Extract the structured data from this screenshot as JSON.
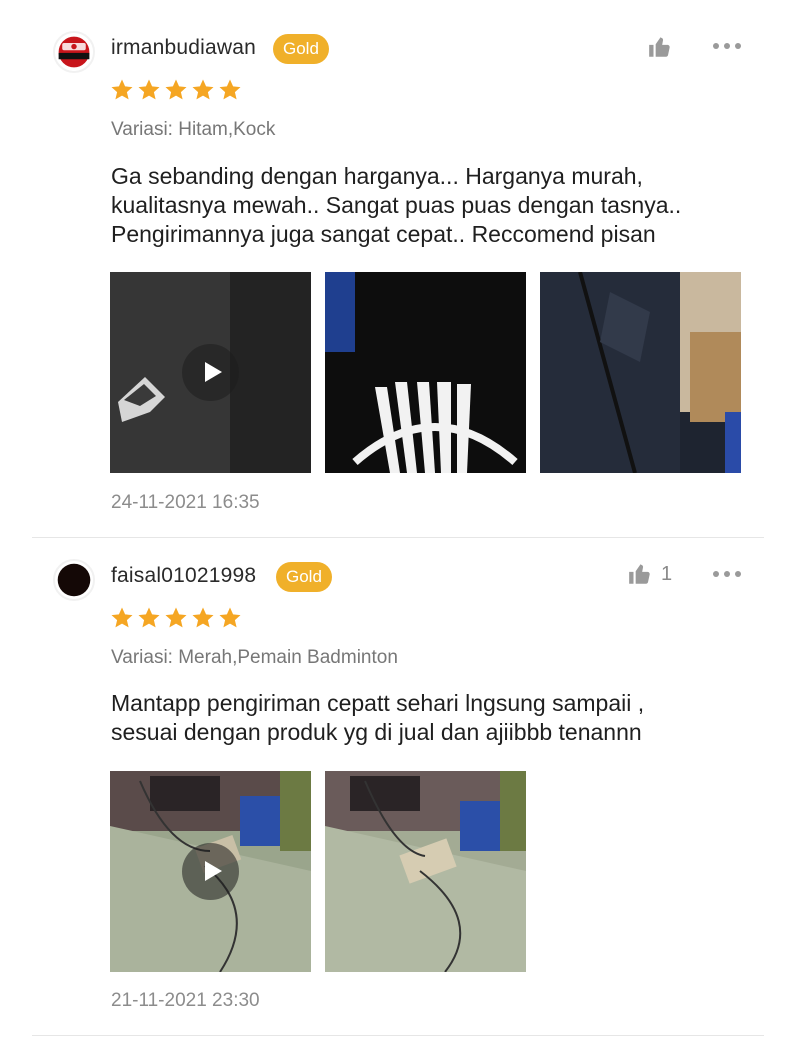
{
  "reviews": [
    {
      "username": "irmanbudiawan",
      "badge": "Gold",
      "rating": 5,
      "variant": "Variasi: Hitam,Kock",
      "text_lines": [
        "Ga sebanding dengan harganya... Harganya murah,",
        "kualitasnya mewah.. Sangat puas puas dengan tasnya..",
        "Pengirimannya juga sangat cepat.. Reccomend pisan"
      ],
      "like_count": "",
      "media": [
        {
          "kind": "video"
        },
        {
          "kind": "image"
        },
        {
          "kind": "image"
        }
      ],
      "date": "24-11-2021 16:35"
    },
    {
      "username": "faisal01021998",
      "badge": "Gold",
      "rating": 5,
      "variant": "Variasi: Merah,Pemain Badminton",
      "text_lines": [
        "Mantapp pengiriman cepatt sehari lngsung sampaii ,",
        "sesuai dengan produk yg di jual dan ajiibbb tenannn"
      ],
      "like_count": "1",
      "media": [
        {
          "kind": "video"
        },
        {
          "kind": "image"
        }
      ],
      "date": "21-11-2021 23:30"
    }
  ],
  "colors": {
    "badge": "#f0b02a",
    "star": "#f5a623",
    "muted_text": "#777777",
    "divider": "#e6e6e6"
  },
  "icons": {
    "like": "thumbs-up-icon",
    "more": "more-dots-icon",
    "star": "star-icon",
    "play": "play-icon"
  }
}
